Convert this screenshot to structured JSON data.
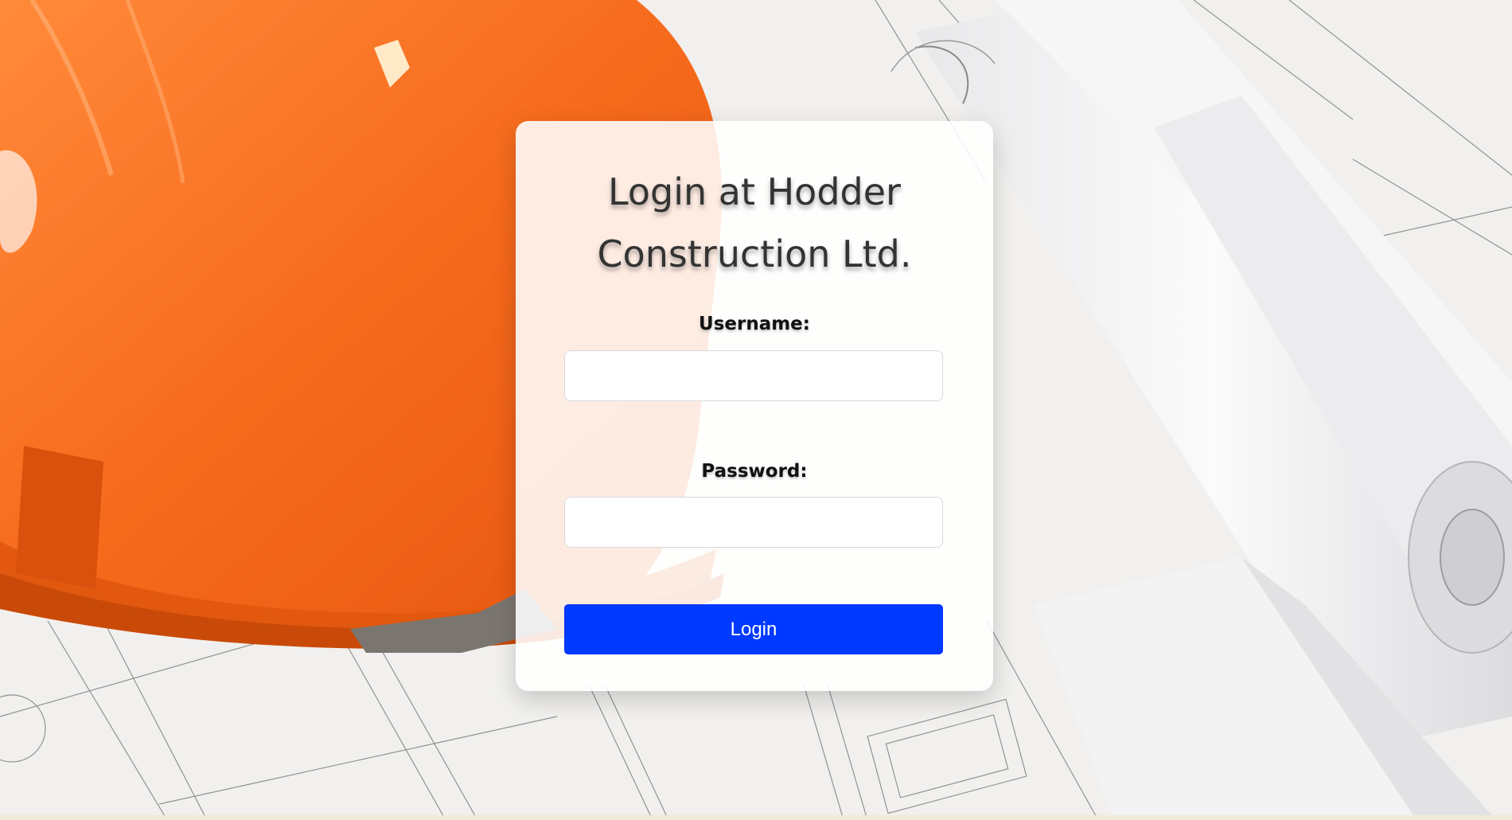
{
  "login": {
    "title_line1": "Login at Hodder",
    "title_line2": "Construction Ltd.",
    "username_label": "Username:",
    "username_value": "",
    "password_label": "Password:",
    "password_value": "",
    "login_button": "Login"
  },
  "colors": {
    "accent": "#0039ff",
    "helmet": "#f5651a"
  },
  "background": {
    "image_subject": "hard-hat-and-blueprints"
  }
}
